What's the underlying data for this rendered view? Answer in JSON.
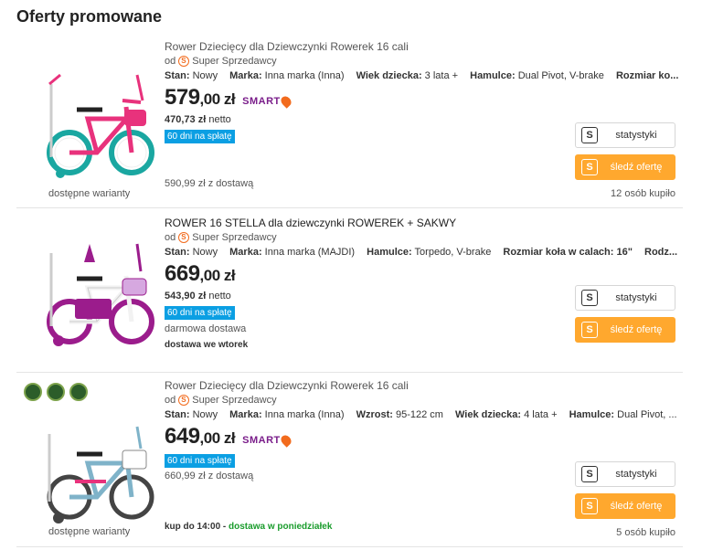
{
  "section_title": "Oferty promowane",
  "colors": {
    "installment_bg": "#0b9fe3",
    "follow_bg": "#ffa82e",
    "price": "#222222",
    "delivery_green": "#1a9c2c"
  },
  "offers": [
    {
      "name": "Rower Dziecięcy dla Dziewczynki Rowerek 16 cali",
      "seller_prefix": "od",
      "seller": "Super Sprzedawcy",
      "params": [
        {
          "k": "Stan:",
          "v": "Nowy"
        },
        {
          "k": "Marka:",
          "v": "Inna marka (Inna)"
        },
        {
          "k": "Wiek dziecka:",
          "v": "3 lata +"
        },
        {
          "k": "Hamulce:",
          "v": "Dual Pivot, V-brake"
        },
        {
          "k": "Rozmiar ko...",
          "v": ""
        }
      ],
      "price_int": "579",
      "price_dec": ",00 zł",
      "smart": "SMART",
      "netto_value": "470,73 zł",
      "netto_label": "netto",
      "installment": "60 dni na spłatę",
      "delivery": "590,99 zł z dostawą",
      "variants": "dostępne warianty",
      "bought": "12 osób kupiło",
      "stats_label": "statystyki",
      "follow_label": "śledź ofertę"
    },
    {
      "name": "ROWER 16 STELLA dla dziewczynki ROWEREK + SAKWY",
      "seller_prefix": "od",
      "seller": "Super Sprzedawcy",
      "params": [
        {
          "k": "Stan:",
          "v": "Nowy"
        },
        {
          "k": "Marka:",
          "v": "Inna marka (MAJDI)"
        },
        {
          "k": "Hamulce:",
          "v": "Torpedo, V-brake"
        },
        {
          "k": "Rozmiar koła w calach:",
          "v": "16\""
        },
        {
          "k": "Rodz...",
          "v": ""
        }
      ],
      "price_int": "669",
      "price_dec": ",00 zł",
      "netto_value": "543,90 zł",
      "netto_label": "netto",
      "installment": "60 dni na spłatę",
      "delivery": "darmowa dostawa",
      "delivery_note": "dostawa we wtorek",
      "stats_label": "statystyki",
      "follow_label": "śledź ofertę"
    },
    {
      "name": "Rower Dziecięcy dla Dziewczynki Rowerek 16 cali",
      "seller_prefix": "od",
      "seller": "Super Sprzedawcy",
      "params": [
        {
          "k": "Stan:",
          "v": "Nowy"
        },
        {
          "k": "Marka:",
          "v": "Inna marka (Inna)"
        },
        {
          "k": "Wzrost:",
          "v": "95-122 cm"
        },
        {
          "k": "Wiek dziecka:",
          "v": "4 lata +"
        },
        {
          "k": "Hamulce:",
          "v": "Dual Pivot, ..."
        }
      ],
      "price_int": "649",
      "price_dec": ",00 zł",
      "smart": "SMART",
      "installment": "60 dni na spłatę",
      "delivery": "660,99 zł z dostawą",
      "order_by": "kup do 14:00",
      "order_sep": " - ",
      "order_delivery": "dostawa w poniedziałek",
      "variants": "dostępne warianty",
      "bought": "5 osób kupiło",
      "stats_label": "statystyki",
      "follow_label": "śledź ofertę"
    }
  ]
}
